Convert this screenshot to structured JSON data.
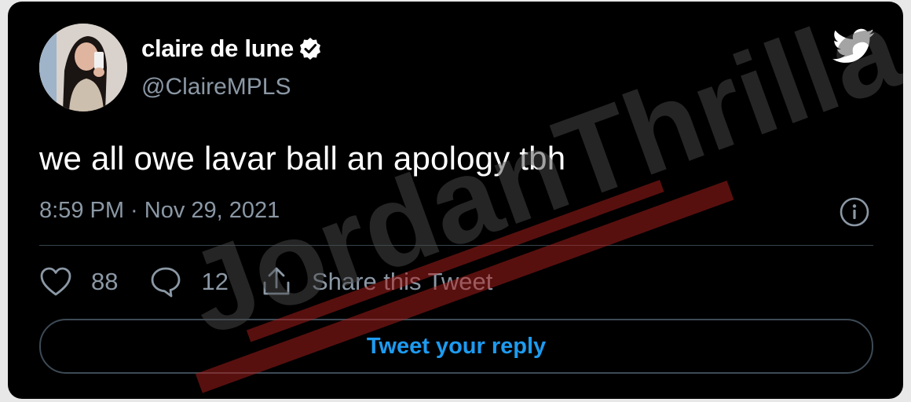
{
  "tweet": {
    "display_name": "claire de lune",
    "handle": "@ClaireMPLS",
    "text": "we all owe lavar ball an apology tbh",
    "timestamp": "8:59 PM · Nov 29, 2021",
    "verified": true
  },
  "actions": {
    "likes": "88",
    "replies": "12",
    "share_label": "Share this Tweet"
  },
  "reply": {
    "label": "Tweet your reply"
  },
  "watermark": {
    "text": "JordanThrilla."
  },
  "colors": {
    "background": "#000000",
    "text_primary": "#ffffff",
    "text_secondary": "#8b98a5",
    "accent": "#1d9bf0",
    "watermark_red": "#b0201c"
  },
  "icons": [
    "verified-badge-icon",
    "twitter-bird-icon",
    "info-icon",
    "heart-icon",
    "comment-icon",
    "share-icon"
  ]
}
